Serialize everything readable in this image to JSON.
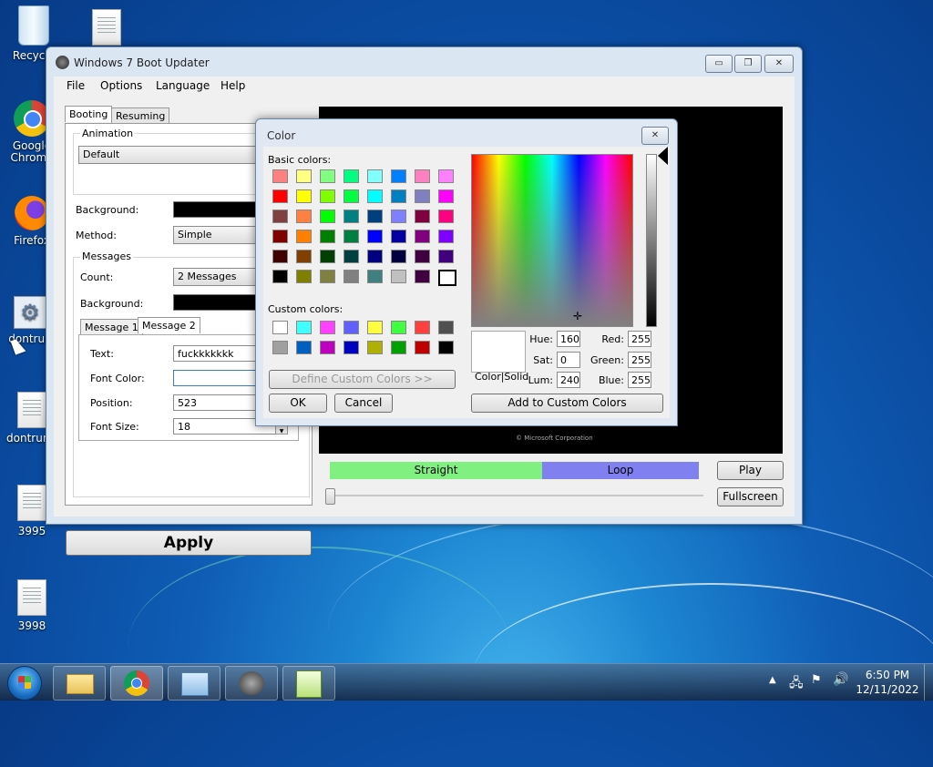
{
  "desktop": {
    "icons": [
      {
        "label": "Recycle",
        "name": "recycle-bin"
      },
      {
        "label": "Google Chrome",
        "name": "chrome"
      },
      {
        "label": "Firefox",
        "name": "firefox"
      },
      {
        "label": "dontrun",
        "name": "dontrun-setup"
      },
      {
        "label": "dontrun.t",
        "name": "dontrun-file"
      },
      {
        "label": "3995",
        "name": "file-3995"
      },
      {
        "label": "3998",
        "name": "file-3998"
      }
    ]
  },
  "window": {
    "title": "Windows 7 Boot Updater",
    "menu": [
      "File",
      "Options",
      "Language",
      "Help"
    ],
    "tabs": [
      "Booting",
      "Resuming"
    ],
    "animation_group": "Animation",
    "animation_value": "Default",
    "background_label": "Background:",
    "method_label": "Method:",
    "method_value": "Simple",
    "messages_group": "Messages",
    "count_label": "Count:",
    "count_value": "2 Messages",
    "msg_background_label": "Background:",
    "msg_tabs": [
      "Message 1",
      "Message 2"
    ],
    "text_label": "Text:",
    "text_value": "fuckkkkkkk",
    "font_color_label": "Font Color:",
    "position_label": "Position:",
    "position_value": "523",
    "font_size_label": "Font Size:",
    "font_size_value": "18",
    "apply_label": "Apply",
    "preview_caption": "© Microsoft Corporation",
    "straight_label": "Straight",
    "loop_label": "Loop",
    "play_label": "Play",
    "fullscreen_label": "Fullscreen"
  },
  "color_dialog": {
    "title": "Color",
    "basic_colors_label": "Basic colors:",
    "basic_colors": [
      "#ff8080",
      "#ffff80",
      "#80ff80",
      "#00ff80",
      "#80ffff",
      "#0080ff",
      "#ff80c0",
      "#ff80ff",
      "#ff0000",
      "#ffff00",
      "#80ff00",
      "#00ff40",
      "#00ffff",
      "#0080c0",
      "#8080c0",
      "#ff00ff",
      "#804040",
      "#ff8040",
      "#00ff00",
      "#008080",
      "#004080",
      "#8080ff",
      "#800040",
      "#ff0080",
      "#800000",
      "#ff8000",
      "#008000",
      "#008040",
      "#0000ff",
      "#0000a0",
      "#800080",
      "#8000ff",
      "#400000",
      "#804000",
      "#004000",
      "#004040",
      "#000080",
      "#000040",
      "#400040",
      "#400080",
      "#000000",
      "#808000",
      "#808040",
      "#808080",
      "#408080",
      "#c0c0c0",
      "#400040",
      "#ffffff"
    ],
    "custom_colors_label": "Custom colors:",
    "custom_colors": [
      "#ffffff",
      "#40ffff",
      "#ff40ff",
      "#6060ff",
      "#ffff40",
      "#40ff40",
      "#ff4040",
      "#505050",
      "#a0a0a0",
      "#0060c0",
      "#c000c0",
      "#0000c0",
      "#b0b000",
      "#00a000",
      "#c00000",
      "#000000"
    ],
    "define_custom_label": "Define Custom Colors >>",
    "ok_label": "OK",
    "cancel_label": "Cancel",
    "color_solid_label": "Color|Solid",
    "hue_label": "Hue:",
    "hue_value": "160",
    "sat_label": "Sat:",
    "sat_value": "0",
    "lum_label": "Lum:",
    "lum_value": "240",
    "red_label": "Red:",
    "red_value": "255",
    "green_label": "Green:",
    "green_value": "255",
    "blue_label": "Blue:",
    "blue_value": "255",
    "add_custom_label": "Add to Custom Colors"
  },
  "taskbar": {
    "apps": [
      "start-button",
      "explorer",
      "chrome",
      "control-panel",
      "boot-updater",
      "notepad-plus-plus"
    ],
    "time": "6:50 PM",
    "date": "12/11/2022"
  }
}
